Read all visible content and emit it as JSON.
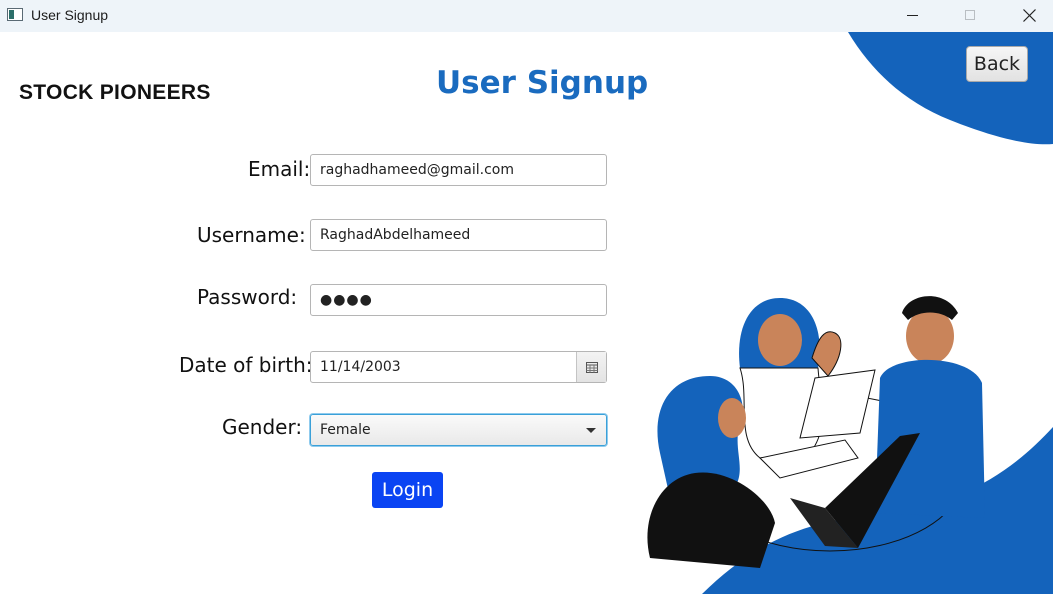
{
  "window": {
    "title": "User Signup",
    "controls": [
      "minimize-icon",
      "maximize-icon",
      "close-icon"
    ]
  },
  "brand": "STOCK PIONEERS",
  "page_title": "User Signup",
  "back_label": "Back",
  "form": {
    "email": {
      "label": "Email:",
      "value": "raghadhameed@gmail.com"
    },
    "username": {
      "label": "Username:",
      "value": "RaghadAbdelhameed"
    },
    "password": {
      "label": "Password:",
      "masked": "●●●●"
    },
    "dob": {
      "label": "Date of birth:",
      "value": "11/14/2003",
      "icon": "calendar-icon"
    },
    "gender": {
      "label": "Gender:",
      "value": "Female"
    }
  },
  "login_label": "Login",
  "colors": {
    "accent": "#1a6bbf",
    "blob": "#1463bb",
    "login": "#0a44f3"
  }
}
